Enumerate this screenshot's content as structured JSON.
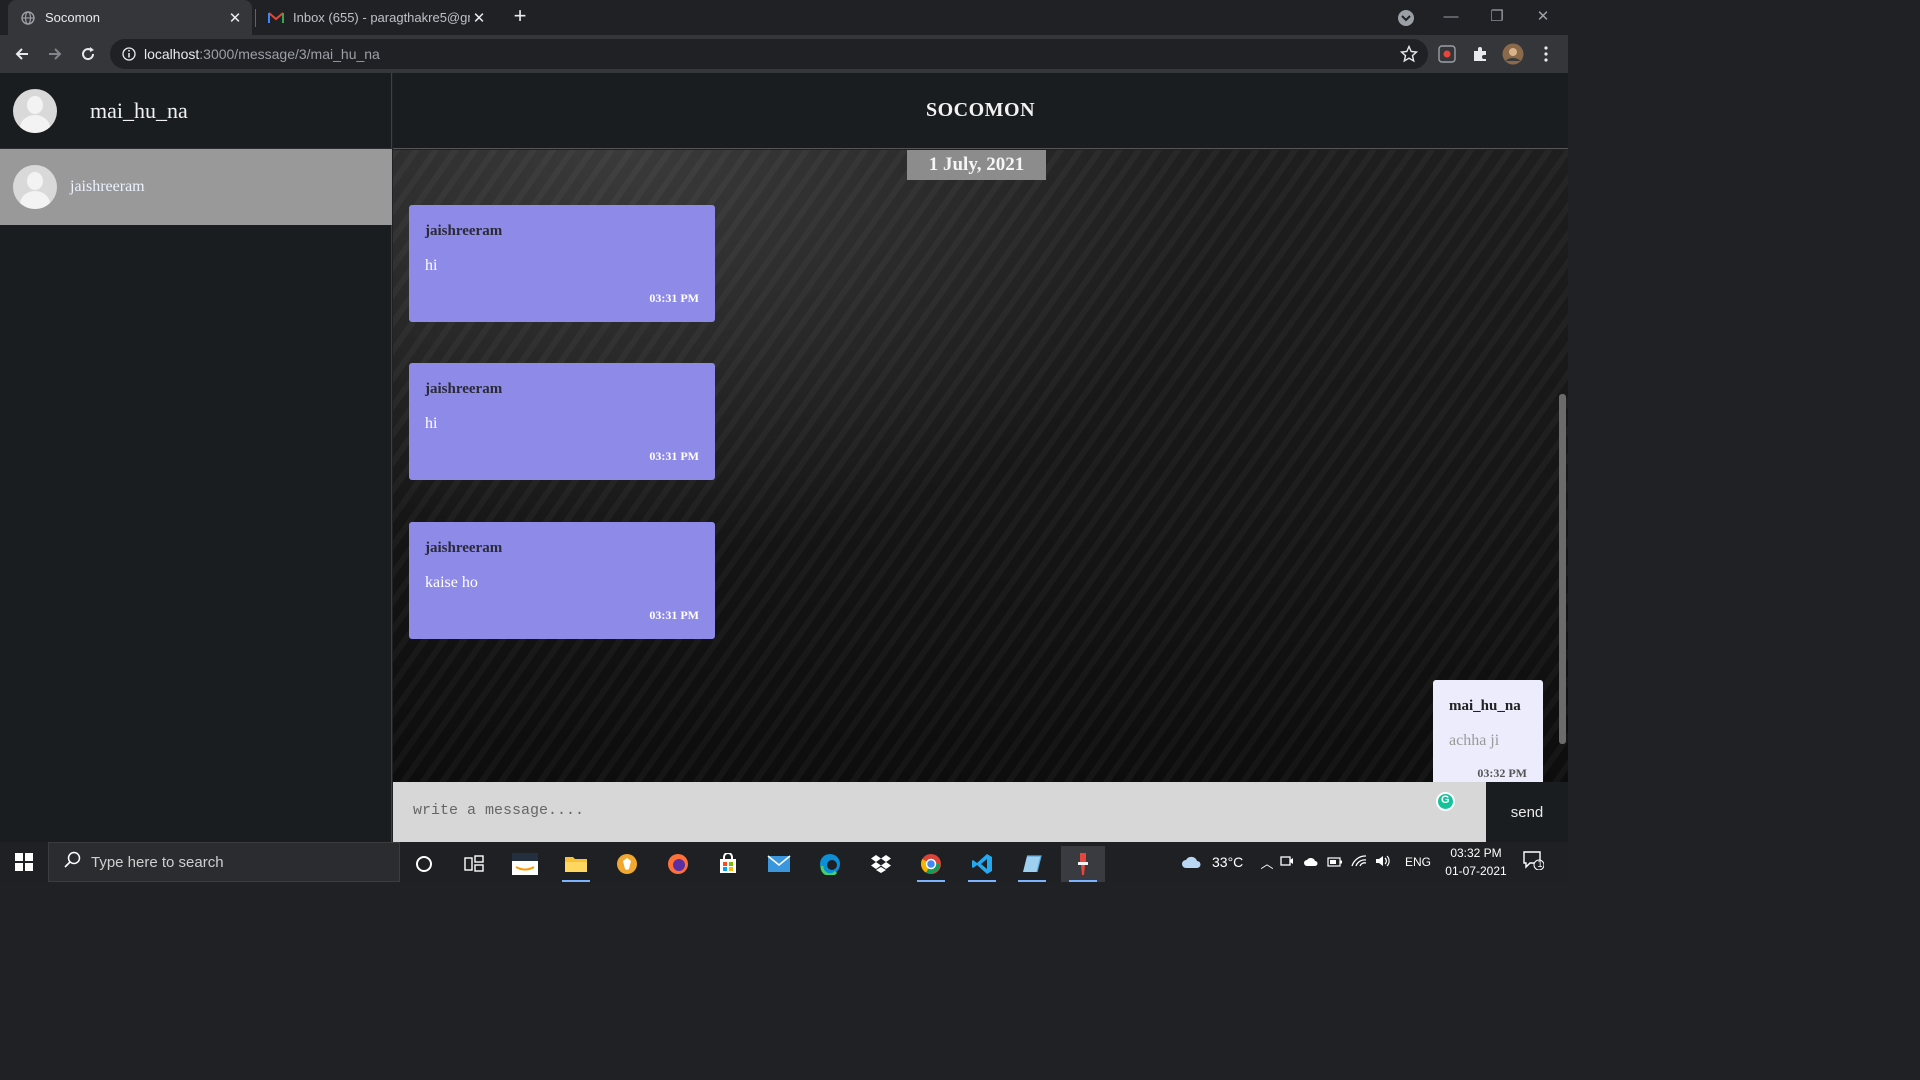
{
  "browser": {
    "tabs": [
      {
        "title": "Socomon",
        "active": true
      },
      {
        "title": "Inbox (655) - paragthakre5@gma",
        "active": false
      }
    ],
    "url_host": "localhost",
    "url_path": ":3000/message/3/mai_hu_na"
  },
  "sidebar": {
    "current_user": "mai_hu_na",
    "contacts": [
      {
        "name": "jaishreeram",
        "selected": true
      }
    ]
  },
  "chat": {
    "brand": "SOCOMON",
    "date": "1 July, 2021",
    "messages": [
      {
        "sender": "jaishreeram",
        "text": "hi",
        "time": "03:31 PM",
        "mine": false
      },
      {
        "sender": "jaishreeram",
        "text": "hi",
        "time": "03:31 PM",
        "mine": false
      },
      {
        "sender": "jaishreeram",
        "text": "kaise ho",
        "time": "03:31 PM",
        "mine": false
      },
      {
        "sender": "mai_hu_na",
        "text": "achha ji",
        "time": "03:32 PM",
        "mine": true
      }
    ],
    "composer": {
      "placeholder": "write a message....",
      "send_label": "send"
    }
  },
  "taskbar": {
    "search_placeholder": "Type here to search",
    "weather": "33°C",
    "language": "ENG",
    "time": "03:32 PM",
    "date": "01-07-2021",
    "notification_count": "1"
  },
  "colors": {
    "incoming_bubble": "#8e8ae8",
    "outgoing_bubble": "#ececfc",
    "selected_contact": "#999999",
    "sidebar_bg": "#1a1d20"
  }
}
